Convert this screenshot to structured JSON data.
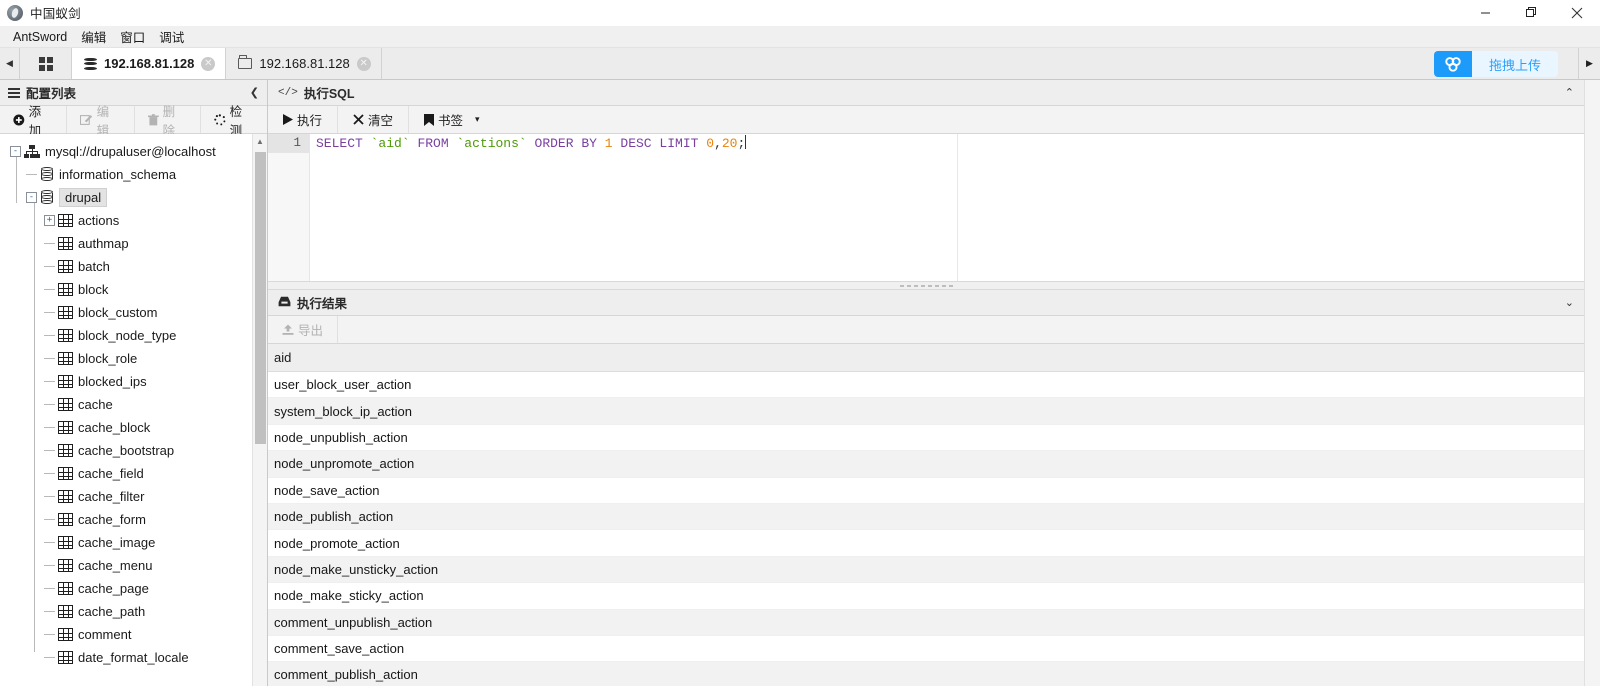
{
  "window": {
    "title": "中国蚁剑",
    "logo_icon": "antsword-logo-icon",
    "minimize_icon": "minimize-icon",
    "maximize_icon": "restore-icon",
    "close_icon": "close-icon"
  },
  "menu": {
    "items": [
      {
        "label": "AntSword"
      },
      {
        "label": "编辑"
      },
      {
        "label": "窗口"
      },
      {
        "label": "调试"
      }
    ]
  },
  "tabbar": {
    "scroll_left_icon": "chevron-left-icon",
    "scroll_right_icon": "chevron-right-icon",
    "home_icon": "grid-apps-icon",
    "tabs": [
      {
        "label": "192.168.81.128",
        "icon": "database-icon",
        "active": true,
        "close_icon": "close-icon"
      },
      {
        "label": "192.168.81.128",
        "icon": "folder-icon",
        "active": false,
        "close_icon": "close-icon"
      }
    ],
    "upload": {
      "label": "拖拽上传",
      "icon": "cloud-upload-icon",
      "icon_bg": "#1c9bfb",
      "label_bg": "#eaf6ff",
      "label_color": "#2aa0fb"
    }
  },
  "sidebar": {
    "header": {
      "title": "配置列表",
      "icon": "list-icon",
      "collapse_icon": "chevron-left-icon"
    },
    "toolbar": [
      {
        "label": "添加",
        "icon": "plus-circle-icon",
        "disabled": false
      },
      {
        "label": "编辑",
        "icon": "pencil-square-icon",
        "disabled": true
      },
      {
        "label": "删除",
        "icon": "trash-icon",
        "disabled": true
      },
      {
        "label": "检测",
        "icon": "spinner-dots-icon",
        "disabled": false
      }
    ],
    "tree": {
      "root": {
        "label": "mysql://drupaluser@localhost",
        "icon": "server-icon",
        "toggle": "-",
        "expanded": true
      },
      "databases": [
        {
          "label": "information_schema",
          "icon": "database-cylinder-icon",
          "toggle": "",
          "selected": false
        },
        {
          "label": "drupal",
          "icon": "database-cylinder-icon",
          "toggle": "-",
          "selected": true
        }
      ],
      "tables": [
        {
          "label": "actions",
          "icon": "table-icon",
          "toggle": "+"
        },
        {
          "label": "authmap",
          "icon": "table-icon",
          "toggle": ""
        },
        {
          "label": "batch",
          "icon": "table-icon",
          "toggle": ""
        },
        {
          "label": "block",
          "icon": "table-icon",
          "toggle": ""
        },
        {
          "label": "block_custom",
          "icon": "table-icon",
          "toggle": ""
        },
        {
          "label": "block_node_type",
          "icon": "table-icon",
          "toggle": ""
        },
        {
          "label": "block_role",
          "icon": "table-icon",
          "toggle": ""
        },
        {
          "label": "blocked_ips",
          "icon": "table-icon",
          "toggle": ""
        },
        {
          "label": "cache",
          "icon": "table-icon",
          "toggle": ""
        },
        {
          "label": "cache_block",
          "icon": "table-icon",
          "toggle": ""
        },
        {
          "label": "cache_bootstrap",
          "icon": "table-icon",
          "toggle": ""
        },
        {
          "label": "cache_field",
          "icon": "table-icon",
          "toggle": ""
        },
        {
          "label": "cache_filter",
          "icon": "table-icon",
          "toggle": ""
        },
        {
          "label": "cache_form",
          "icon": "table-icon",
          "toggle": ""
        },
        {
          "label": "cache_image",
          "icon": "table-icon",
          "toggle": ""
        },
        {
          "label": "cache_menu",
          "icon": "table-icon",
          "toggle": ""
        },
        {
          "label": "cache_page",
          "icon": "table-icon",
          "toggle": ""
        },
        {
          "label": "cache_path",
          "icon": "table-icon",
          "toggle": ""
        },
        {
          "label": "comment",
          "icon": "table-icon",
          "toggle": ""
        },
        {
          "label": "date_format_locale",
          "icon": "table-icon",
          "toggle": ""
        }
      ]
    },
    "scrollbar": {
      "up_arrow_icon": "triangle-up-icon"
    }
  },
  "sql_panel": {
    "header": {
      "title": "执行SQL",
      "tag": "</>",
      "chevron_icon": "chevron-up-icon"
    },
    "toolbar": [
      {
        "label": "执行",
        "icon": "play-icon"
      },
      {
        "label": "清空",
        "icon": "times-icon"
      },
      {
        "label": "书签",
        "icon": "bookmark-icon",
        "caret": "▾"
      }
    ],
    "editor": {
      "line_number": "1",
      "query": "SELECT `aid` FROM `actions` ORDER BY 1 DESC LIMIT 0,20;",
      "tokens": [
        {
          "t": "SELECT",
          "c": "kw"
        },
        {
          "t": " ",
          "c": "pn"
        },
        {
          "t": "`aid`",
          "c": "id"
        },
        {
          "t": " ",
          "c": "pn"
        },
        {
          "t": "FROM",
          "c": "kw"
        },
        {
          "t": " ",
          "c": "pn"
        },
        {
          "t": "`actions`",
          "c": "id"
        },
        {
          "t": " ",
          "c": "pn"
        },
        {
          "t": "ORDER",
          "c": "kw"
        },
        {
          "t": " ",
          "c": "pn"
        },
        {
          "t": "BY",
          "c": "kw"
        },
        {
          "t": " ",
          "c": "pn"
        },
        {
          "t": "1",
          "c": "num"
        },
        {
          "t": " ",
          "c": "pn"
        },
        {
          "t": "DESC",
          "c": "kw"
        },
        {
          "t": " ",
          "c": "pn"
        },
        {
          "t": "LIMIT",
          "c": "kw"
        },
        {
          "t": " ",
          "c": "pn"
        },
        {
          "t": "0",
          "c": "num"
        },
        {
          "t": ",",
          "c": "pn"
        },
        {
          "t": "20",
          "c": "num"
        },
        {
          "t": ";",
          "c": "pn"
        }
      ]
    }
  },
  "result_panel": {
    "header": {
      "title": "执行结果",
      "icon": "inbox-icon",
      "chevron_icon": "chevron-down-icon"
    },
    "toolbar": [
      {
        "label": "导出",
        "icon": "export-upload-icon",
        "disabled": true
      }
    ],
    "columns": [
      "aid"
    ],
    "rows": [
      [
        "user_block_user_action"
      ],
      [
        "system_block_ip_action"
      ],
      [
        "node_unpublish_action"
      ],
      [
        "node_unpromote_action"
      ],
      [
        "node_save_action"
      ],
      [
        "node_publish_action"
      ],
      [
        "node_promote_action"
      ],
      [
        "node_make_unsticky_action"
      ],
      [
        "node_make_sticky_action"
      ],
      [
        "comment_unpublish_action"
      ],
      [
        "comment_save_action"
      ],
      [
        "comment_publish_action"
      ]
    ]
  }
}
